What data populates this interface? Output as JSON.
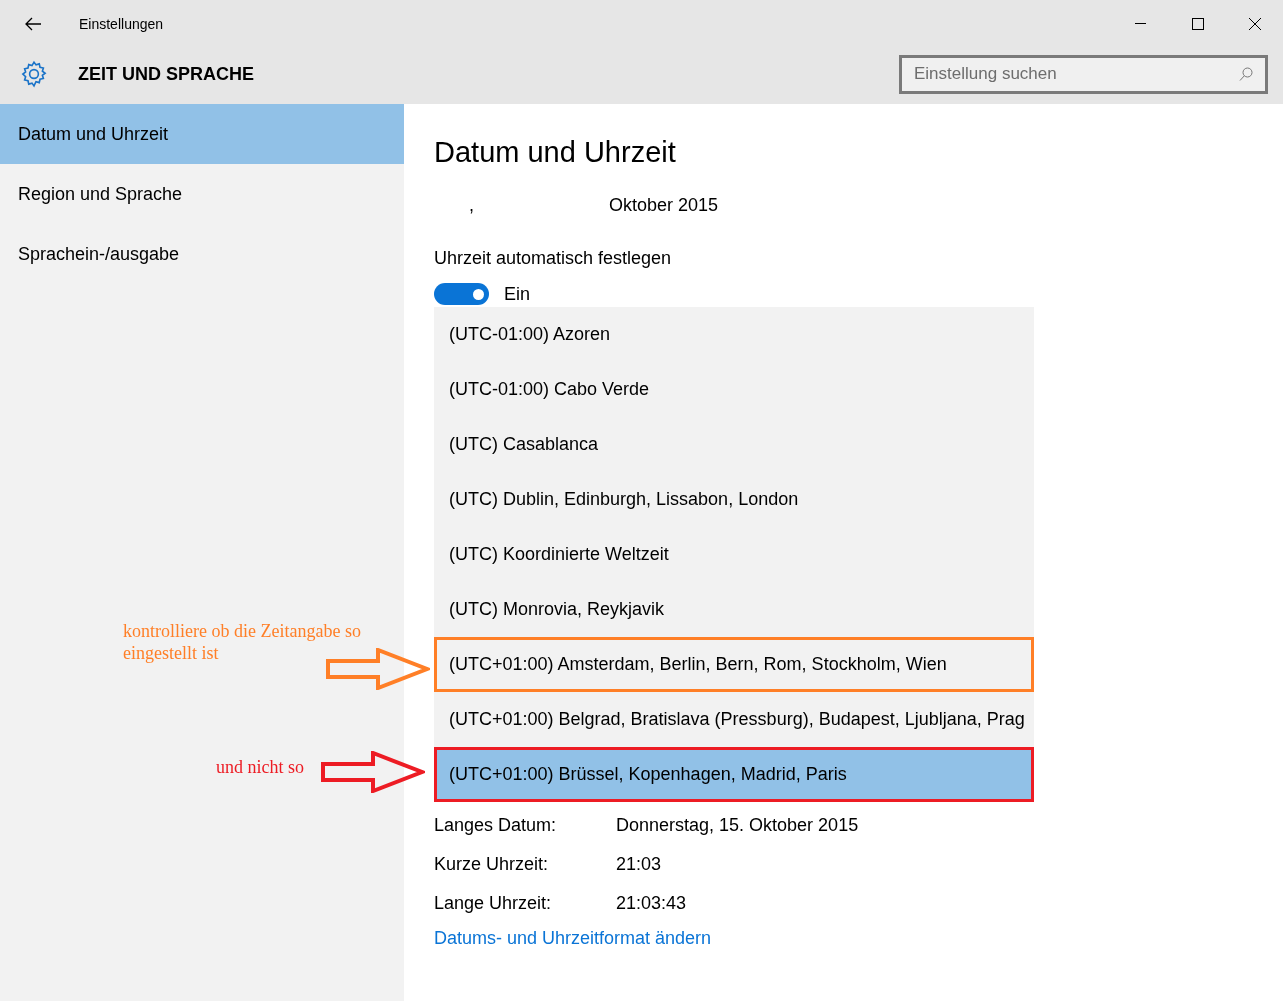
{
  "window": {
    "title": "Einstellungen"
  },
  "header": {
    "title": "ZEIT UND SPRACHE",
    "search": {
      "placeholder": "Einstellung suchen"
    }
  },
  "sidebar": {
    "items": [
      {
        "label": "Datum und Uhrzeit",
        "selected": true
      },
      {
        "label": "Region und Sprache",
        "selected": false
      },
      {
        "label": "Sprachein-/ausgabe",
        "selected": false
      }
    ]
  },
  "content": {
    "title": "Datum und Uhrzeit",
    "date_parts": [
      ",",
      "Oktober 2015"
    ],
    "auto_time": {
      "label": "Uhrzeit automatisch festlegen",
      "on": true,
      "state_label": "Ein"
    },
    "timezones": [
      {
        "label": "(UTC-01:00) Azoren",
        "selected": false
      },
      {
        "label": "(UTC-01:00) Cabo Verde",
        "selected": false
      },
      {
        "label": "(UTC) Casablanca",
        "selected": false
      },
      {
        "label": "(UTC) Dublin, Edinburgh, Lissabon, London",
        "selected": false
      },
      {
        "label": "(UTC) Koordinierte Weltzeit",
        "selected": false
      },
      {
        "label": "(UTC) Monrovia, Reykjavik",
        "selected": false
      },
      {
        "label": "(UTC+01:00) Amsterdam, Berlin, Bern, Rom, Stockholm, Wien",
        "selected": false,
        "color": "#ff7f27"
      },
      {
        "label": "(UTC+01:00) Belgrad, Bratislava (Pressburg), Budapest, Ljubljana, Prag",
        "selected": false
      },
      {
        "label": "(UTC+01:00) Brüssel, Kopenhagen, Madrid, Paris",
        "selected": true,
        "color": "#ed1c24"
      }
    ],
    "formats": [
      {
        "label": "Langes Datum:",
        "value": "Donnerstag, 15. Oktober 2015"
      },
      {
        "label": "Kurze Uhrzeit:",
        "value": "21:03"
      },
      {
        "label": "Lange Uhrzeit:",
        "value": "21:03:43"
      }
    ],
    "link": "Datums- und Uhrzeitformat ändern"
  },
  "annotations": [
    {
      "text": "kontrolliere ob die Zeitangabe so eingestellt ist",
      "color": "#ff7f27"
    },
    {
      "text": "und nicht so",
      "color": "#ed1c24"
    }
  ]
}
